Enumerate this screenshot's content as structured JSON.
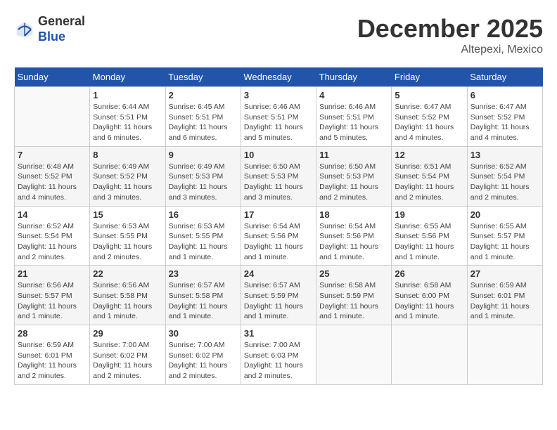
{
  "header": {
    "logo_general": "General",
    "logo_blue": "Blue",
    "month_title": "December 2025",
    "location": "Altepexi, Mexico"
  },
  "weekdays": [
    "Sunday",
    "Monday",
    "Tuesday",
    "Wednesday",
    "Thursday",
    "Friday",
    "Saturday"
  ],
  "weeks": [
    [
      {
        "day": "",
        "sunrise": "",
        "sunset": "",
        "daylight": ""
      },
      {
        "day": "1",
        "sunrise": "Sunrise: 6:44 AM",
        "sunset": "Sunset: 5:51 PM",
        "daylight": "Daylight: 11 hours and 6 minutes."
      },
      {
        "day": "2",
        "sunrise": "Sunrise: 6:45 AM",
        "sunset": "Sunset: 5:51 PM",
        "daylight": "Daylight: 11 hours and 6 minutes."
      },
      {
        "day": "3",
        "sunrise": "Sunrise: 6:46 AM",
        "sunset": "Sunset: 5:51 PM",
        "daylight": "Daylight: 11 hours and 5 minutes."
      },
      {
        "day": "4",
        "sunrise": "Sunrise: 6:46 AM",
        "sunset": "Sunset: 5:51 PM",
        "daylight": "Daylight: 11 hours and 5 minutes."
      },
      {
        "day": "5",
        "sunrise": "Sunrise: 6:47 AM",
        "sunset": "Sunset: 5:52 PM",
        "daylight": "Daylight: 11 hours and 4 minutes."
      },
      {
        "day": "6",
        "sunrise": "Sunrise: 6:47 AM",
        "sunset": "Sunset: 5:52 PM",
        "daylight": "Daylight: 11 hours and 4 minutes."
      }
    ],
    [
      {
        "day": "7",
        "sunrise": "Sunrise: 6:48 AM",
        "sunset": "Sunset: 5:52 PM",
        "daylight": "Daylight: 11 hours and 4 minutes."
      },
      {
        "day": "8",
        "sunrise": "Sunrise: 6:49 AM",
        "sunset": "Sunset: 5:52 PM",
        "daylight": "Daylight: 11 hours and 3 minutes."
      },
      {
        "day": "9",
        "sunrise": "Sunrise: 6:49 AM",
        "sunset": "Sunset: 5:53 PM",
        "daylight": "Daylight: 11 hours and 3 minutes."
      },
      {
        "day": "10",
        "sunrise": "Sunrise: 6:50 AM",
        "sunset": "Sunset: 5:53 PM",
        "daylight": "Daylight: 11 hours and 3 minutes."
      },
      {
        "day": "11",
        "sunrise": "Sunrise: 6:50 AM",
        "sunset": "Sunset: 5:53 PM",
        "daylight": "Daylight: 11 hours and 2 minutes."
      },
      {
        "day": "12",
        "sunrise": "Sunrise: 6:51 AM",
        "sunset": "Sunset: 5:54 PM",
        "daylight": "Daylight: 11 hours and 2 minutes."
      },
      {
        "day": "13",
        "sunrise": "Sunrise: 6:52 AM",
        "sunset": "Sunset: 5:54 PM",
        "daylight": "Daylight: 11 hours and 2 minutes."
      }
    ],
    [
      {
        "day": "14",
        "sunrise": "Sunrise: 6:52 AM",
        "sunset": "Sunset: 5:54 PM",
        "daylight": "Daylight: 11 hours and 2 minutes."
      },
      {
        "day": "15",
        "sunrise": "Sunrise: 6:53 AM",
        "sunset": "Sunset: 5:55 PM",
        "daylight": "Daylight: 11 hours and 2 minutes."
      },
      {
        "day": "16",
        "sunrise": "Sunrise: 6:53 AM",
        "sunset": "Sunset: 5:55 PM",
        "daylight": "Daylight: 11 hours and 1 minute."
      },
      {
        "day": "17",
        "sunrise": "Sunrise: 6:54 AM",
        "sunset": "Sunset: 5:56 PM",
        "daylight": "Daylight: 11 hours and 1 minute."
      },
      {
        "day": "18",
        "sunrise": "Sunrise: 6:54 AM",
        "sunset": "Sunset: 5:56 PM",
        "daylight": "Daylight: 11 hours and 1 minute."
      },
      {
        "day": "19",
        "sunrise": "Sunrise: 6:55 AM",
        "sunset": "Sunset: 5:56 PM",
        "daylight": "Daylight: 11 hours and 1 minute."
      },
      {
        "day": "20",
        "sunrise": "Sunrise: 6:55 AM",
        "sunset": "Sunset: 5:57 PM",
        "daylight": "Daylight: 11 hours and 1 minute."
      }
    ],
    [
      {
        "day": "21",
        "sunrise": "Sunrise: 6:56 AM",
        "sunset": "Sunset: 5:57 PM",
        "daylight": "Daylight: 11 hours and 1 minute."
      },
      {
        "day": "22",
        "sunrise": "Sunrise: 6:56 AM",
        "sunset": "Sunset: 5:58 PM",
        "daylight": "Daylight: 11 hours and 1 minute."
      },
      {
        "day": "23",
        "sunrise": "Sunrise: 6:57 AM",
        "sunset": "Sunset: 5:58 PM",
        "daylight": "Daylight: 11 hours and 1 minute."
      },
      {
        "day": "24",
        "sunrise": "Sunrise: 6:57 AM",
        "sunset": "Sunset: 5:59 PM",
        "daylight": "Daylight: 11 hours and 1 minute."
      },
      {
        "day": "25",
        "sunrise": "Sunrise: 6:58 AM",
        "sunset": "Sunset: 5:59 PM",
        "daylight": "Daylight: 11 hours and 1 minute."
      },
      {
        "day": "26",
        "sunrise": "Sunrise: 6:58 AM",
        "sunset": "Sunset: 6:00 PM",
        "daylight": "Daylight: 11 hours and 1 minute."
      },
      {
        "day": "27",
        "sunrise": "Sunrise: 6:59 AM",
        "sunset": "Sunset: 6:01 PM",
        "daylight": "Daylight: 11 hours and 1 minute."
      }
    ],
    [
      {
        "day": "28",
        "sunrise": "Sunrise: 6:59 AM",
        "sunset": "Sunset: 6:01 PM",
        "daylight": "Daylight: 11 hours and 2 minutes."
      },
      {
        "day": "29",
        "sunrise": "Sunrise: 7:00 AM",
        "sunset": "Sunset: 6:02 PM",
        "daylight": "Daylight: 11 hours and 2 minutes."
      },
      {
        "day": "30",
        "sunrise": "Sunrise: 7:00 AM",
        "sunset": "Sunset: 6:02 PM",
        "daylight": "Daylight: 11 hours and 2 minutes."
      },
      {
        "day": "31",
        "sunrise": "Sunrise: 7:00 AM",
        "sunset": "Sunset: 6:03 PM",
        "daylight": "Daylight: 11 hours and 2 minutes."
      },
      {
        "day": "",
        "sunrise": "",
        "sunset": "",
        "daylight": ""
      },
      {
        "day": "",
        "sunrise": "",
        "sunset": "",
        "daylight": ""
      },
      {
        "day": "",
        "sunrise": "",
        "sunset": "",
        "daylight": ""
      }
    ]
  ]
}
